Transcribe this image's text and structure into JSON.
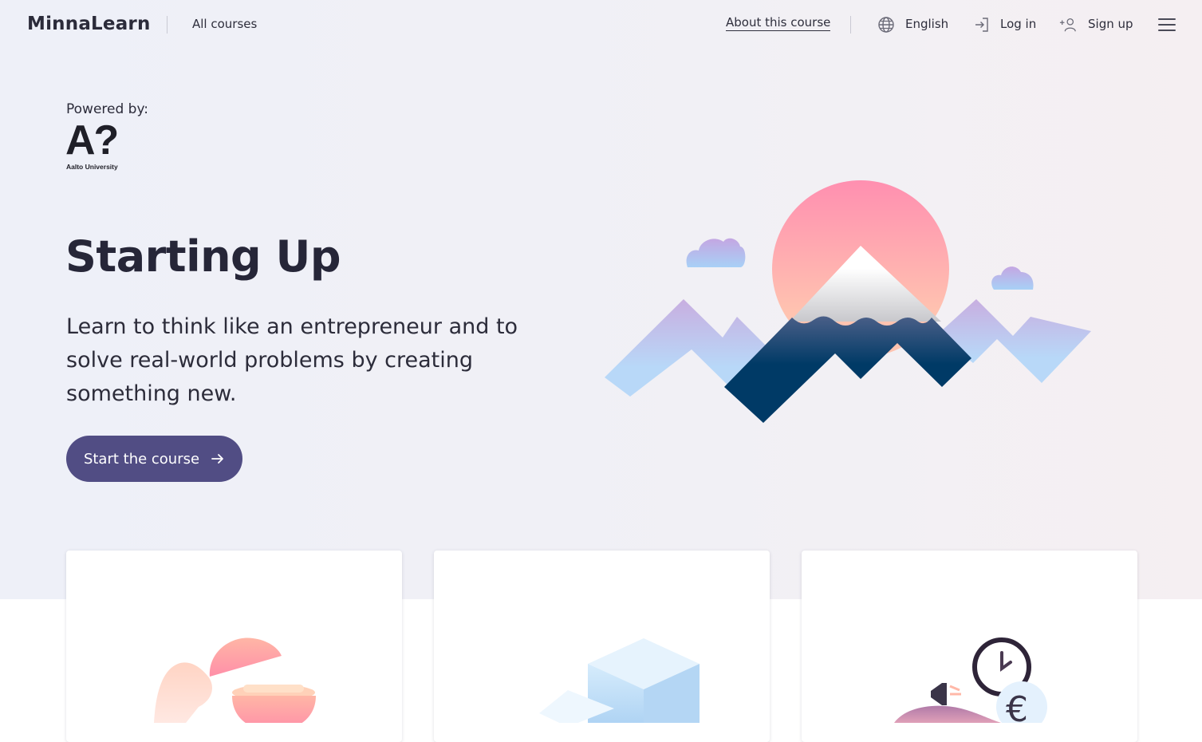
{
  "header": {
    "logo": "MinnaLearn",
    "all_courses": "All courses",
    "about": "About this course",
    "language": "English",
    "login": "Log in",
    "signup": "Sign up",
    "icons": [
      "globe-icon",
      "login-icon",
      "add-user-icon",
      "menu-icon"
    ]
  },
  "hero": {
    "powered_by": "Powered by:",
    "partner_mark": "A?",
    "partner_name": "Aalto University",
    "title": "Starting Up",
    "subtitle": "Learn to think like an entrepreneur and to solve real-world problems by creating something new.",
    "cta": "Start the course"
  },
  "colors": {
    "accent": "#514d84",
    "text": "#2b2b3a",
    "navy": "#003a66",
    "pink": "#ff8fb0"
  }
}
